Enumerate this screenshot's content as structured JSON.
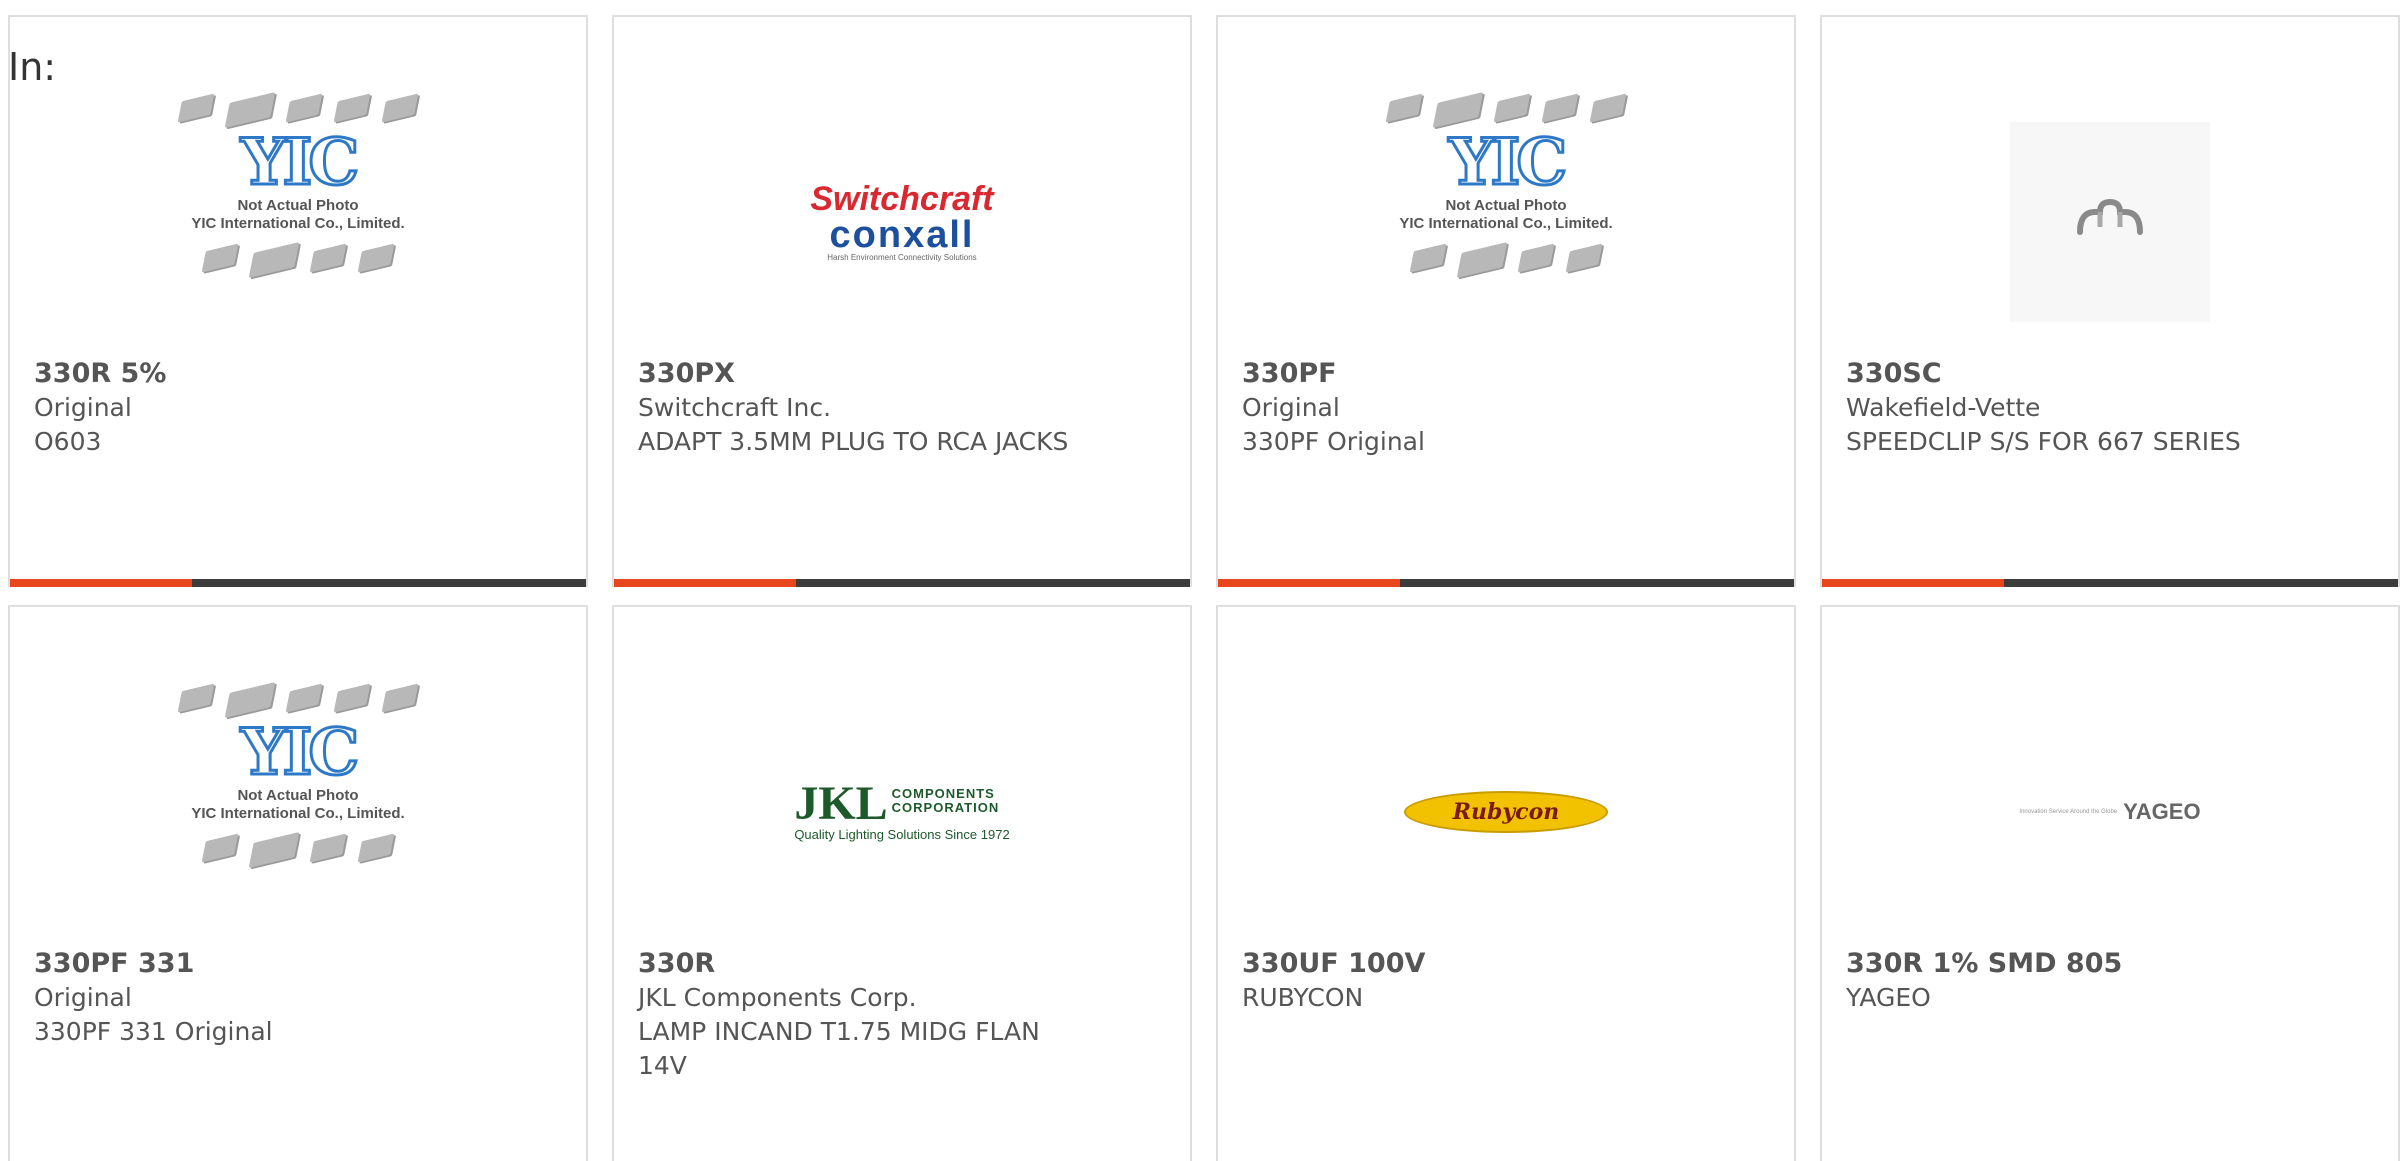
{
  "header": {
    "in_label": "In:"
  },
  "image_texts": {
    "yic_logo": "YIC",
    "yic_caption_1": "Not Actual Photo",
    "yic_caption_2": "YIC International Co., Limited.",
    "switchcraft_1": "Switchcraft",
    "switchcraft_2": "conxall",
    "switchcraft_3": "Harsh Environment Connectivity Solutions",
    "jkl_big": "JKL",
    "jkl_small_1": "COMPONENTS",
    "jkl_small_2": "CORPORATION",
    "jkl_tag": "Quality Lighting Solutions Since 1972",
    "rubycon": "Rubycon",
    "yageo_tiny": "Innovation Service Around the Globe",
    "yageo_name": "YAGEO"
  },
  "products": [
    {
      "part_number": "330R 5%",
      "manufacturer": "Original",
      "description": "O603",
      "image": "yic-placeholder"
    },
    {
      "part_number": "330PX",
      "manufacturer": "Switchcraft Inc.",
      "description": "ADAPT 3.5MM PLUG TO RCA JACKS",
      "image": "switchcraft-logo"
    },
    {
      "part_number": "330PF",
      "manufacturer": "Original",
      "description": "330PF Original",
      "image": "yic-placeholder"
    },
    {
      "part_number": "330SC",
      "manufacturer": "Wakefield-Vette",
      "description": "SPEEDCLIP S/S FOR 667 SERIES",
      "image": "speedclip-photo"
    },
    {
      "part_number": "330PF 331",
      "manufacturer": "Original",
      "description": "330PF 331 Original",
      "image": "yic-placeholder"
    },
    {
      "part_number": "330R",
      "manufacturer": "JKL Components Corp.",
      "description": "LAMP INCAND T1.75 MIDG FLAN 14V",
      "image": "jkl-logo"
    },
    {
      "part_number": "330UF 100V",
      "manufacturer": "RUBYCON",
      "description": "",
      "image": "rubycon-logo"
    },
    {
      "part_number": "330R 1% SMD 805",
      "manufacturer": "YAGEO",
      "description": "",
      "image": "yageo-logo"
    }
  ],
  "colors": {
    "accent": "#e8461c",
    "bar_dark": "#3c3c3c",
    "text": "#555555"
  }
}
